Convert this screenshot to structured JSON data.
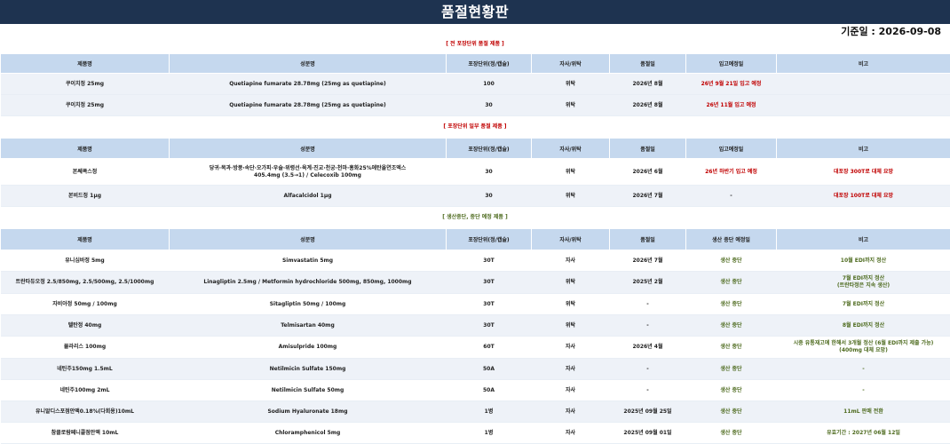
{
  "page": {
    "title": "품절현황판",
    "ref_date": "기준일 : 2026-09-08"
  },
  "sections": [
    {
      "title": "[ 전 포장단위 품절 제품 ]",
      "headers": [
        "제품명",
        "성분명",
        "포장단위(정/캡슐)",
        "자사/위탁",
        "품절일",
        "입고예정일",
        "비고"
      ],
      "rows": [
        [
          "쿠이치정 25mg",
          "Quetiapine fumarate 28.78mg (25mg as quetiapine)",
          "100",
          "위탁",
          "2026년 8월",
          "26년 9월 21일 입고 예정",
          ""
        ],
        [
          "쿠이치정 25mg",
          "Quetiapine fumarate 28.78mg (25mg as quetiapine)",
          "30",
          "위탁",
          "2026년 8월",
          "26년 11월 입고 예정",
          ""
        ]
      ]
    },
    {
      "title": "[ 포장단위 일부 품절 제품 ]",
      "headers": [
        "제품명",
        "성분명",
        "포장단위(정/캡슐)",
        "자사/위탁",
        "품절일",
        "입고예정일",
        "비고"
      ],
      "rows": [
        [
          "본쎄콕스정",
          "당귀·목과·방풍·속단·오가피·우슬·위령선·육계·진교·천궁·천마·홍화25%에탄올연조엑스\n405.4mg (3.5→1) / Celecoxib 100mg",
          "30",
          "위탁",
          "2026년 6월",
          "26년 하반기 입고 예정",
          "대포장 300T로 대체 요망"
        ],
        [
          "본비드정 1μg",
          "Alfacalcidol 1μg",
          "30",
          "위탁",
          "2026년 7월",
          "-",
          "대포장 100T로 대체 요망"
        ]
      ]
    },
    {
      "title": "[ 생산중단, 중단 예정 제품 ]",
      "headers": [
        "제품명",
        "성분명",
        "포장단위(정/캡슐)",
        "자사/위탁",
        "품절일",
        "생산 중단 예정일",
        "비고"
      ],
      "rows": [
        [
          "유니심바정 5mg",
          "Simvastatin 5mg",
          "30T",
          "자사",
          "2026년 7월",
          "생산 중단",
          "10월 EDI까지 정산"
        ],
        [
          "트란타듀오정 2.5/850mg, 2.5/500mg, 2.5/1000mg",
          "Linagliptin 2.5mg / Metformin hydrochloride 500mg, 850mg, 1000mg",
          "30T",
          "위탁",
          "2025년 2월",
          "생산 중단",
          "7월 EDI까지 정산\n(트란타정은 지속 생산)"
        ],
        [
          "자비아정 50mg / 100mg",
          "Sitagliptin 50mg / 100mg",
          "30T",
          "위탁",
          "-",
          "생산 중단",
          "7월 EDI까지 정산"
        ],
        [
          "텔탄정 40mg",
          "Telmisartan 40mg",
          "30T",
          "위탁",
          "-",
          "생산 중단",
          "8월 EDI까지 정산"
        ],
        [
          "뮬라리스 100mg",
          "Amisulpride 100mg",
          "60T",
          "자사",
          "2026년 4월",
          "생산 중단",
          "시중 유통재고에 한해서 3개월 정산 (6월 EDI까지 제출 가능)\n(400mg 대체 요망)"
        ],
        [
          "네틴주150mg 1.5mL",
          "Netilmicin Sulfate 150mg",
          "50A",
          "자사",
          "-",
          "생산 중단",
          "-"
        ],
        [
          "네틴주100mg 2mL",
          "Netilmicin Sulfate 50mg",
          "50A",
          "자사",
          "-",
          "생산 중단",
          "-"
        ],
        [
          "유니알디스포점안액0.18%(다회용)10mL",
          "Sodium Hyaluronate 18mg",
          "1병",
          "자사",
          "2025년 09월 25일",
          "생산 중단",
          "11mL 판매 전환"
        ],
        [
          "참클로람페니콜점안액 10mL",
          "Chloramphenicol 5mg",
          "1병",
          "자사",
          "2025년 09월 01일",
          "생산 중단",
          "유효기간 : 2027년 06월 12일"
        ]
      ]
    }
  ],
  "colors": {
    "title_bg": "#1e3350",
    "header_bg": "#c5d8ee",
    "alt_row_bg": "#eef2f8",
    "red_text": "#c00000",
    "green_text": "#4e6b1f"
  }
}
